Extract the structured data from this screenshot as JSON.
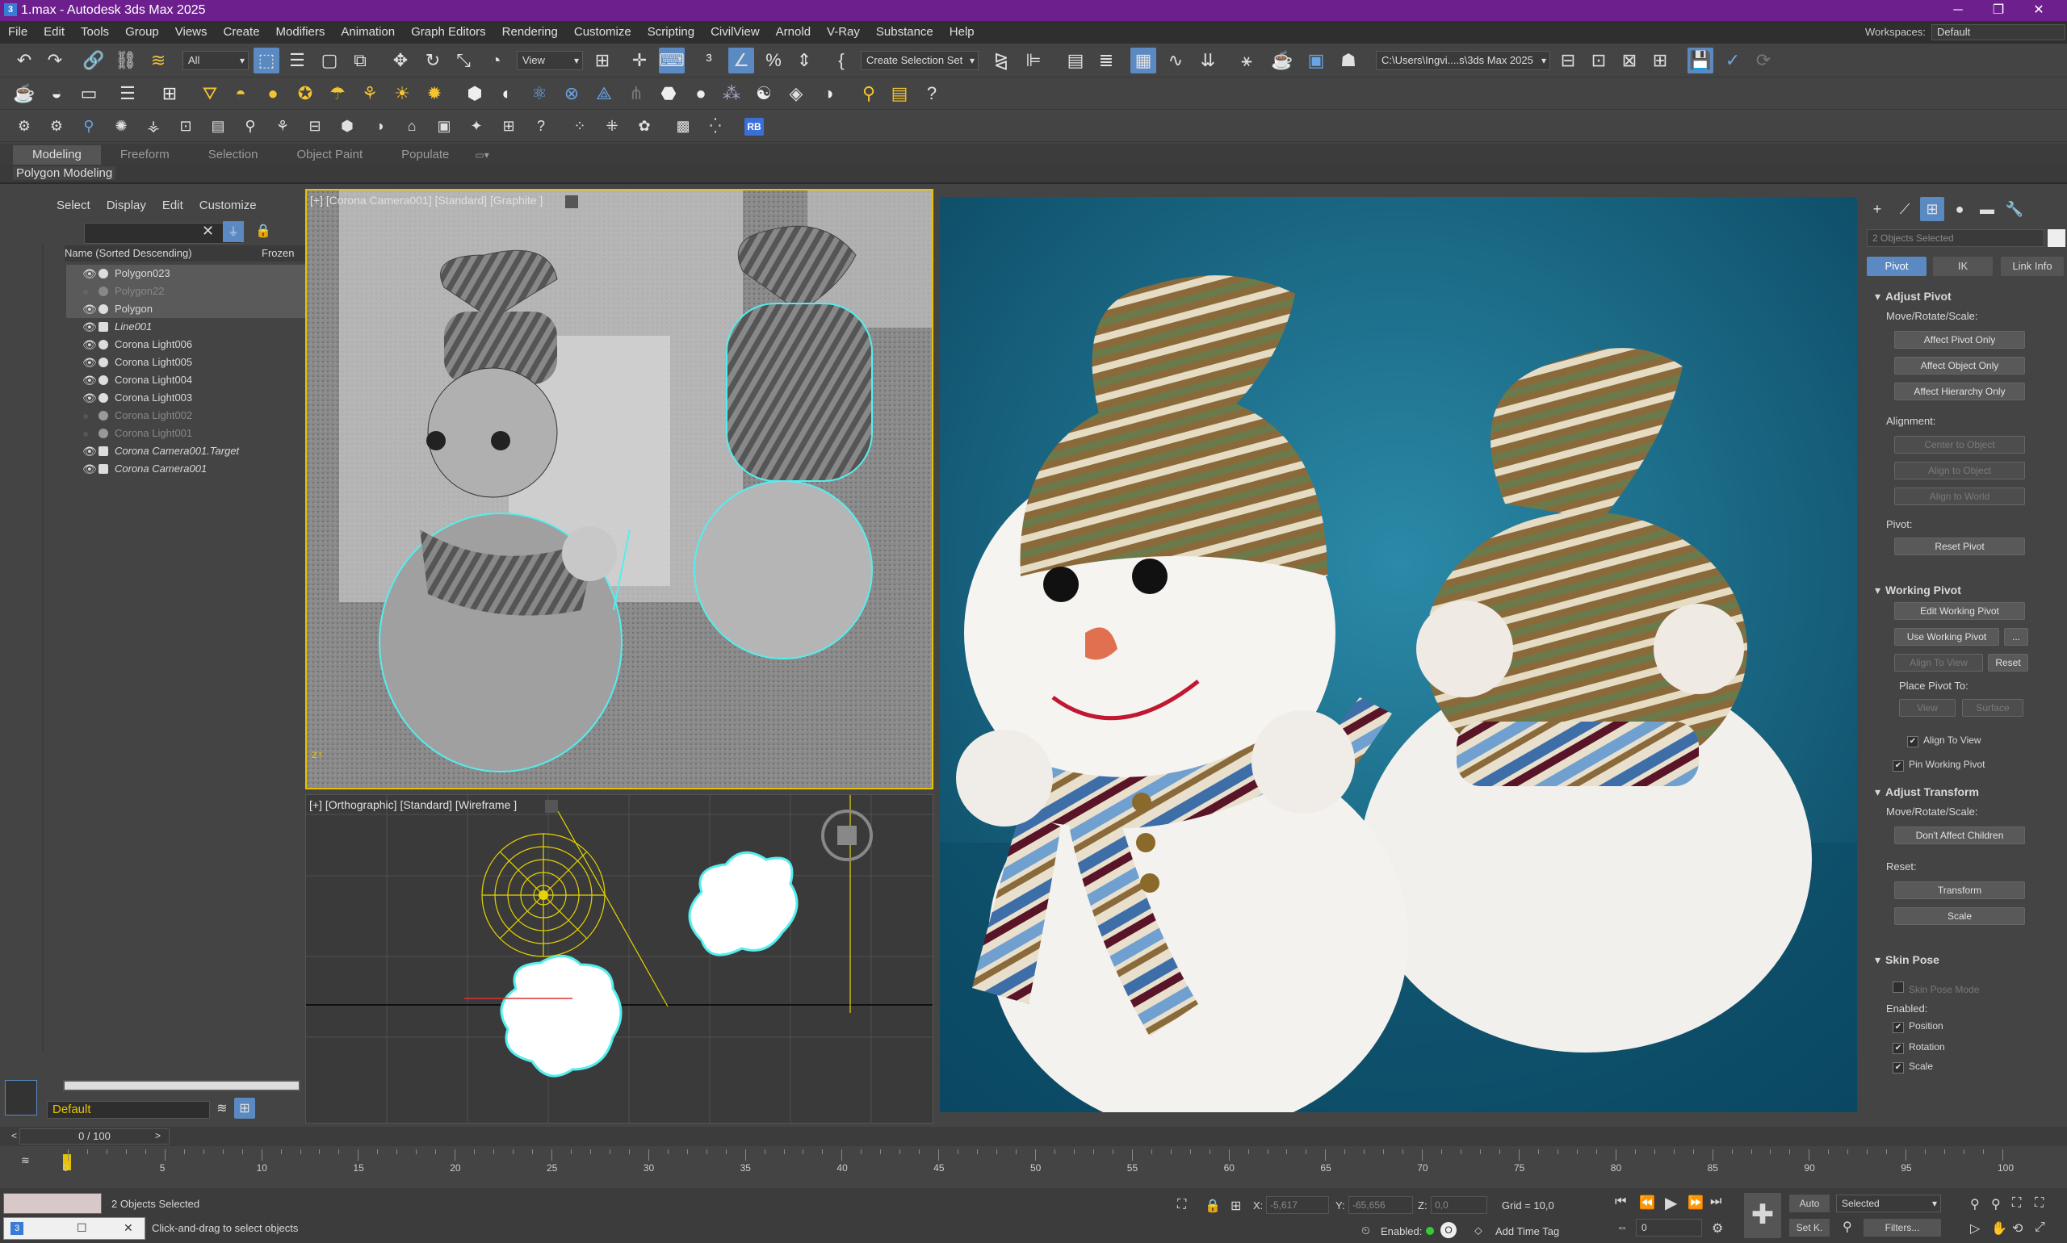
{
  "window": {
    "title": "1.max - Autodesk 3ds Max 2025",
    "app_icon": "3"
  },
  "menu": [
    "File",
    "Edit",
    "Tools",
    "Group",
    "Views",
    "Create",
    "Modifiers",
    "Animation",
    "Graph Editors",
    "Rendering",
    "Customize",
    "Scripting",
    "CivilView",
    "Arnold",
    "V-Ray",
    "Substance",
    "Help"
  ],
  "workspaces": {
    "label": "Workspaces:",
    "value": "Default"
  },
  "toolbar": {
    "filter_value": "All",
    "view_value": "View",
    "selection_set": "Create Selection Set",
    "project_path": "C:\\Users\\Ingvi....s\\3ds Max 2025",
    "rb_badge": "RB"
  },
  "ribbon": {
    "tabs": [
      "Modeling",
      "Freeform",
      "Selection",
      "Object Paint",
      "Populate"
    ],
    "panel_label": "Polygon Modeling"
  },
  "scene_explorer": {
    "menu": [
      "Select",
      "Display",
      "Edit",
      "Customize"
    ],
    "column_name": "Name (Sorted Descending)",
    "column_frozen": "Frozen",
    "rows": [
      {
        "label": "Polygon023"
      },
      {
        "label": "Polygon22"
      },
      {
        "label": "Polygon"
      },
      {
        "label": "Line001"
      },
      {
        "label": "Corona Light006"
      },
      {
        "label": "Corona Light005"
      },
      {
        "label": "Corona Light004"
      },
      {
        "label": "Corona Light003"
      },
      {
        "label": "Corona Light002"
      },
      {
        "label": "Corona Light001"
      },
      {
        "label": "Corona Camera001.Target"
      },
      {
        "label": "Corona Camera001"
      }
    ],
    "layer": "Default"
  },
  "viewports": {
    "top_label": "[+] [Corona Camera001] [Standard] [Graphite ]",
    "bottom_label": "[+] [Orthographic] [Standard] [Wireframe ]"
  },
  "command_panel": {
    "selection": "2 Objects Selected",
    "tabs": [
      "Pivot",
      "IK",
      "Link Info"
    ],
    "adjust_pivot": {
      "title": "Adjust Pivot",
      "move_label": "Move/Rotate/Scale:",
      "buttons": [
        "Affect Pivot Only",
        "Affect Object Only",
        "Affect Hierarchy Only"
      ],
      "alignment_label": "Alignment:",
      "align_buttons": [
        "Center to Object",
        "Align to Object",
        "Align to World"
      ],
      "pivot_label": "Pivot:",
      "reset_pivot": "Reset Pivot"
    },
    "working_pivot": {
      "title": "Working Pivot",
      "edit": "Edit Working Pivot",
      "use": "Use Working Pivot",
      "more": "...",
      "align_to_view": "Align To View",
      "reset": "Reset",
      "place_label": "Place Pivot To:",
      "view": "View",
      "surface": "Surface",
      "chk_align": "Align To View",
      "chk_pin": "Pin Working Pivot"
    },
    "adjust_transform": {
      "title": "Adjust Transform",
      "move_label": "Move/Rotate/Scale:",
      "dont_affect": "Don't Affect Children",
      "reset_label": "Reset:",
      "transform": "Transform",
      "scale": "Scale"
    },
    "skin_pose": {
      "title": "Skin Pose",
      "mode": "Skin Pose Mode",
      "enabled_label": "Enabled:",
      "position": "Position",
      "rotation": "Rotation",
      "scale": "Scale"
    }
  },
  "timeline": {
    "slider": "0 / 100",
    "ticks": [
      "0",
      "5",
      "10",
      "15",
      "20",
      "25",
      "30",
      "35",
      "40",
      "45",
      "50",
      "55",
      "60",
      "65",
      "70",
      "75",
      "80",
      "85",
      "90",
      "95",
      "100"
    ]
  },
  "status": {
    "selected": "2 Objects Selected",
    "prompt": "Click-and-drag to select objects",
    "x_label": "X:",
    "x_value": "-5,617",
    "y_label": "Y:",
    "y_value": "-65,656",
    "z_label": "Z:",
    "z_value": "0,0",
    "grid": "Grid = 10,0",
    "enabled": "Enabled:",
    "add_time_tag": "Add Time Tag",
    "auto": "Auto",
    "set_key": "Set K.",
    "selected_dd": "Selected",
    "frame": "0",
    "filters": "Filters..."
  },
  "colors": {
    "title_bar": "#6e1f8e",
    "active_blue": "#5b89c2",
    "viewport_border": "#e6c300",
    "render_bg": "#0d5a78"
  }
}
